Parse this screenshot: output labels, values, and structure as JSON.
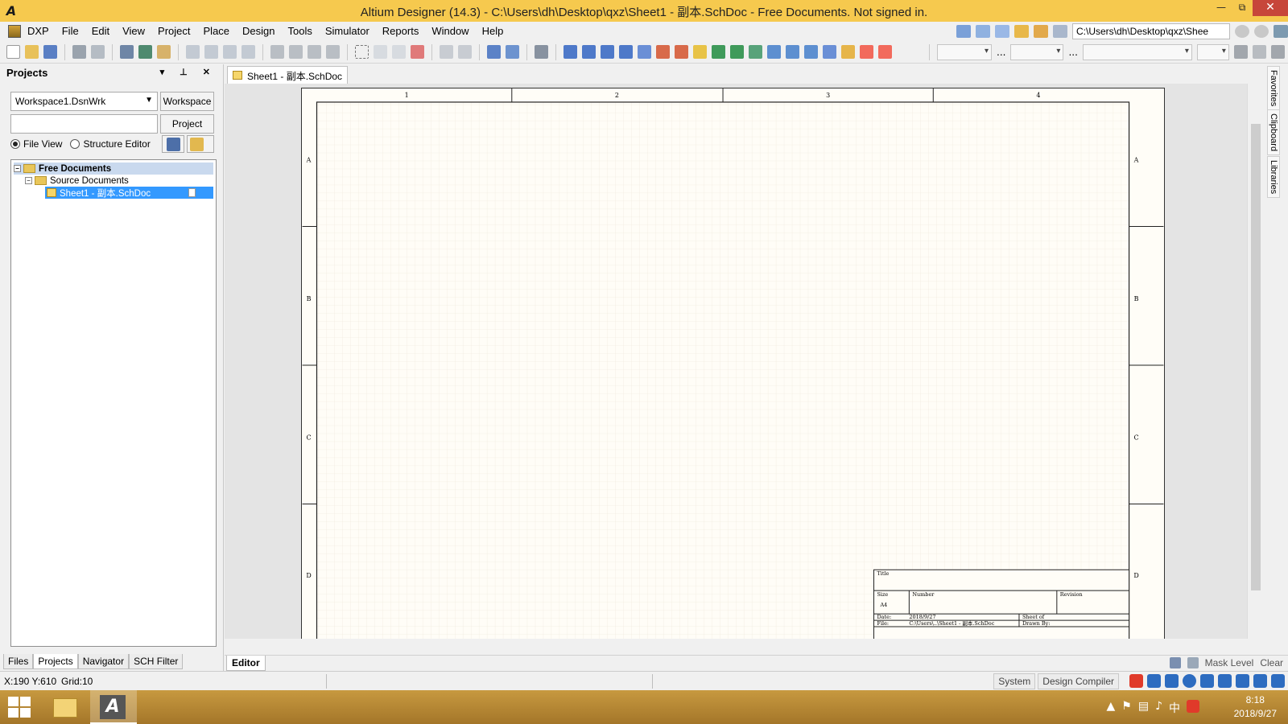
{
  "window": {
    "title": "Altium Designer (14.3) - C:\\Users\\dh\\Desktop\\qxz\\Sheet1 - 副本.SchDoc - Free Documents. Not signed in.",
    "logo": "A"
  },
  "menu": [
    "DXP",
    "File",
    "Edit",
    "View",
    "Project",
    "Place",
    "Design",
    "Tools",
    "Simulator",
    "Reports",
    "Window",
    "Help"
  ],
  "path_box": "C:\\Users\\dh\\Desktop\\qxz\\Shee",
  "projects_panel": {
    "title": "Projects",
    "workspace_value": "Workspace1.DsnWrk",
    "workspace_button": "Workspace",
    "project_button": "Project",
    "file_view_label": "File View",
    "structure_editor_label": "Structure Editor",
    "tree": {
      "root": "Free Documents",
      "folder": "Source Documents",
      "file": "Sheet1 - 副本.SchDoc"
    },
    "bottom_tabs": [
      "Files",
      "Projects",
      "Navigator",
      "SCH Filter"
    ]
  },
  "document_tab": "Sheet1 - 副本.SchDoc",
  "sheet": {
    "column_labels": [
      "1",
      "2",
      "3",
      "4"
    ],
    "row_labels": [
      "A",
      "B",
      "C",
      "D"
    ],
    "title_block": {
      "title_label": "Title",
      "size_label": "Size",
      "size_value": "A4",
      "number_label": "Number",
      "revision_label": "Revision",
      "date_label": "Date:",
      "date_value": "2018/9/27",
      "sheet_label": "Sheet    of",
      "file_label": "File:",
      "file_value": "C:\\Users\\..\\Sheet1 - 副本.SchDoc",
      "drawn_label": "Drawn By:"
    }
  },
  "right_dock_tabs": [
    "Favorites",
    "Clipboard",
    "Libraries"
  ],
  "editor_strip": {
    "editor_tab": "Editor",
    "mask_level": "Mask Level",
    "clear": "Clear"
  },
  "statusbar": {
    "coords": "X:190 Y:610",
    "grid": "Grid:10",
    "system": "System",
    "design_compiler": "Design Compiler"
  },
  "taskbar": {
    "time": "8:18",
    "date": "2018/9/27",
    "ime": "中"
  },
  "colors": {
    "titlebar": "#f6c94e",
    "sheet_bg": "#fffdf7",
    "selection": "#3399ff",
    "taskbar": "#b78734"
  }
}
